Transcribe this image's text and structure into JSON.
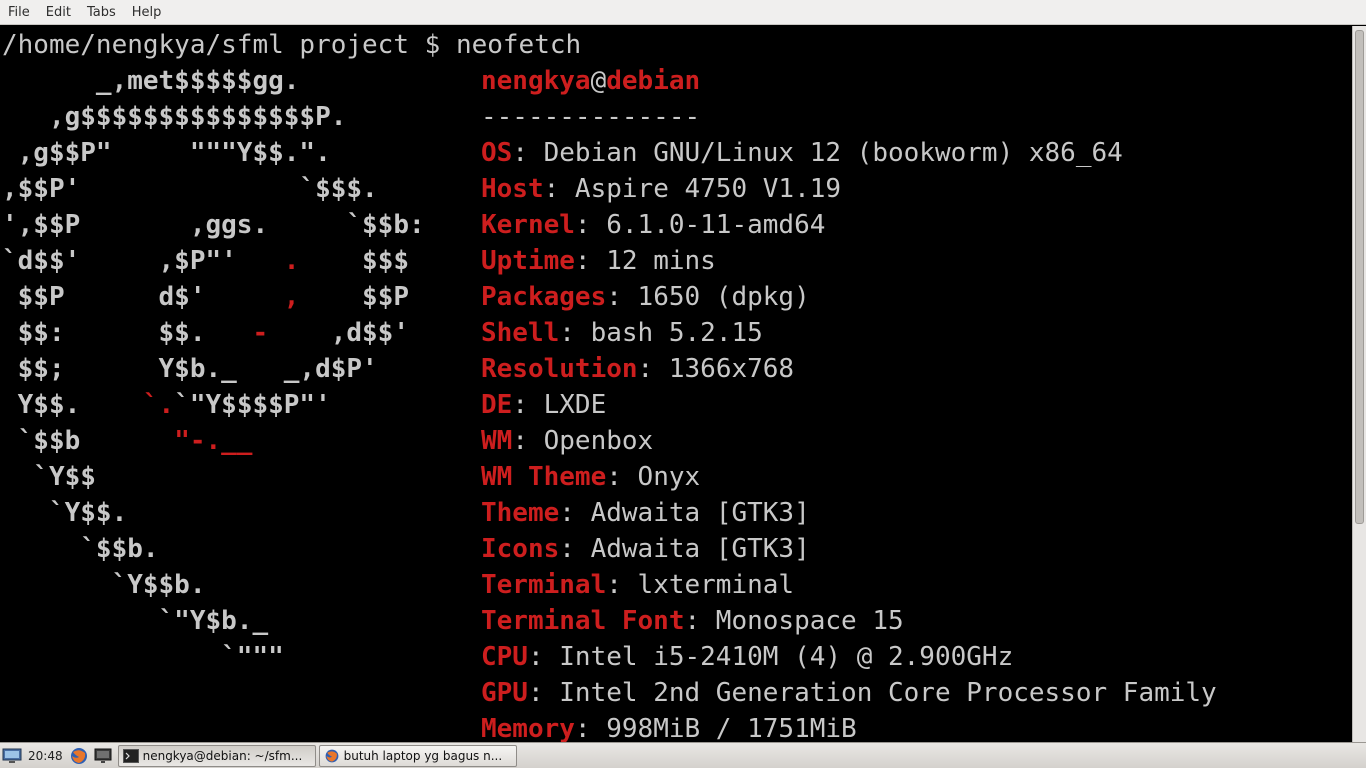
{
  "menubar": {
    "items": [
      "File",
      "Edit",
      "Tabs",
      "Help"
    ]
  },
  "terminal": {
    "prompt": "/home/nengkya/sfml project $ neofetch",
    "logo": [
      {
        "parts": [
          {
            "t": "      _,met$$$$$gg."
          }
        ]
      },
      {
        "parts": [
          {
            "t": "   ,g$$$$$$$$$$$$$$$P."
          }
        ]
      },
      {
        "parts": [
          {
            "t": " ,g$$P\"     \"\"\"Y$$.\"."
          }
        ]
      },
      {
        "parts": [
          {
            "t": ",$$P'              `$$$."
          }
        ]
      },
      {
        "parts": [
          {
            "t": "',$$P       ,ggs.     `$$b:"
          }
        ]
      },
      {
        "parts": [
          {
            "t": "`d$$'     ,$P\"'   "
          },
          {
            "t": ".",
            "c": "red"
          },
          {
            "t": "    $$$"
          }
        ]
      },
      {
        "parts": [
          {
            "t": " $$P      d$'     "
          },
          {
            "t": ",",
            "c": "red"
          },
          {
            "t": "    $$P"
          }
        ]
      },
      {
        "parts": [
          {
            "t": " $$:      $$.   "
          },
          {
            "t": "-",
            "c": "red"
          },
          {
            "t": "    ,d$$'"
          }
        ]
      },
      {
        "parts": [
          {
            "t": " $$;      Y$b._   _,d$P'"
          }
        ]
      },
      {
        "parts": [
          {
            "t": " Y$$.    "
          },
          {
            "t": "`.",
            "c": "red"
          },
          {
            "t": "`\"Y$$$$P\"'"
          }
        ]
      },
      {
        "parts": [
          {
            "t": " `$$b      "
          },
          {
            "t": "\"-.__",
            "c": "red"
          }
        ]
      },
      {
        "parts": [
          {
            "t": "  `Y$$"
          }
        ]
      },
      {
        "parts": [
          {
            "t": "   `Y$$."
          }
        ]
      },
      {
        "parts": [
          {
            "t": "     `$$b."
          }
        ]
      },
      {
        "parts": [
          {
            "t": "       `Y$$b."
          }
        ]
      },
      {
        "parts": [
          {
            "t": "          `\"Y$b._"
          }
        ]
      },
      {
        "parts": [
          {
            "t": "              `\"\"\""
          }
        ]
      }
    ],
    "user": "nengkya",
    "at": "@",
    "host": "debian",
    "separator": "--------------",
    "info": [
      {
        "key": "OS",
        "value": ": Debian GNU/Linux 12 (bookworm) x86_64"
      },
      {
        "key": "Host",
        "value": ": Aspire 4750 V1.19"
      },
      {
        "key": "Kernel",
        "value": ": 6.1.0-11-amd64"
      },
      {
        "key": "Uptime",
        "value": ": 12 mins"
      },
      {
        "key": "Packages",
        "value": ": 1650 (dpkg)"
      },
      {
        "key": "Shell",
        "value": ": bash 5.2.15"
      },
      {
        "key": "Resolution",
        "value": ": 1366x768"
      },
      {
        "key": "DE",
        "value": ": LXDE"
      },
      {
        "key": "WM",
        "value": ": Openbox"
      },
      {
        "key": "WM Theme",
        "value": ": Onyx"
      },
      {
        "key": "Theme",
        "value": ": Adwaita [GTK3]"
      },
      {
        "key": "Icons",
        "value": ": Adwaita [GTK3]"
      },
      {
        "key": "Terminal",
        "value": ": lxterminal"
      },
      {
        "key": "Terminal Font",
        "value": ": Monospace 15"
      },
      {
        "key": "CPU",
        "value": ": Intel i5-2410M (4) @ 2.900GHz"
      },
      {
        "key": "GPU",
        "value": ": Intel 2nd Generation Core Processor Family"
      },
      {
        "key": "Memory",
        "value": ": 998MiB / 1751MiB"
      }
    ]
  },
  "taskbar": {
    "clock": "20:48",
    "tasks": [
      {
        "label": "nengkya@debian: ~/sfm...",
        "icon": "terminal-icon",
        "active": true
      },
      {
        "label": "butuh laptop yg bagus n...",
        "icon": "firefox-icon",
        "active": false
      }
    ]
  },
  "colors": {
    "accent_red": "#cd1e1e",
    "text_gray": "#c8c8c8",
    "background": "#000000"
  }
}
